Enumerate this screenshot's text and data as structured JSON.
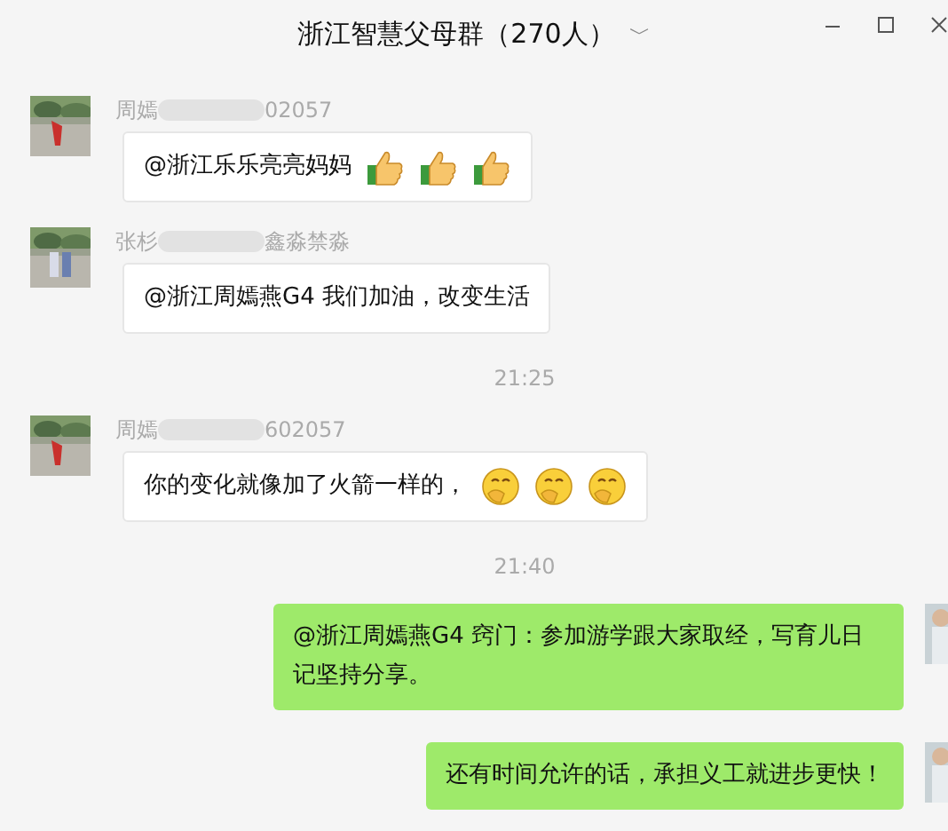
{
  "window": {
    "title": "浙江智慧父母群（270人）",
    "dropdown": "﹀"
  },
  "messages": [
    {
      "kind": "incoming",
      "sender": {
        "start": "周嫣",
        "end": "02057"
      },
      "text": "@浙江乐乐亮亮妈妈",
      "emojis": [
        {
          "kind": "thumbs_up"
        },
        {
          "kind": "thumbs_up"
        },
        {
          "kind": "thumbs_up"
        }
      ]
    },
    {
      "kind": "incoming",
      "sender": {
        "start": "张杉",
        "end": "鑫淼禁淼"
      },
      "text": "@浙江周嫣燕G4 我们加油，改变生活"
    },
    {
      "kind": "time",
      "text": "21:25"
    },
    {
      "kind": "incoming",
      "sender": {
        "start": "周嫣",
        "end": "602057"
      },
      "text": "你的变化就像加了火箭一样的，",
      "emojis": [
        {
          "kind": "smirk"
        },
        {
          "kind": "smirk"
        },
        {
          "kind": "smirk"
        }
      ]
    },
    {
      "kind": "time",
      "text": "21:40"
    },
    {
      "kind": "outgoing",
      "text": "@浙江周嫣燕G4 窍门：参加游学跟大家取经，写育儿日记坚持分享。"
    },
    {
      "kind": "outgoing",
      "text": "还有时间允许的话，承担义工就进步更快！"
    }
  ]
}
